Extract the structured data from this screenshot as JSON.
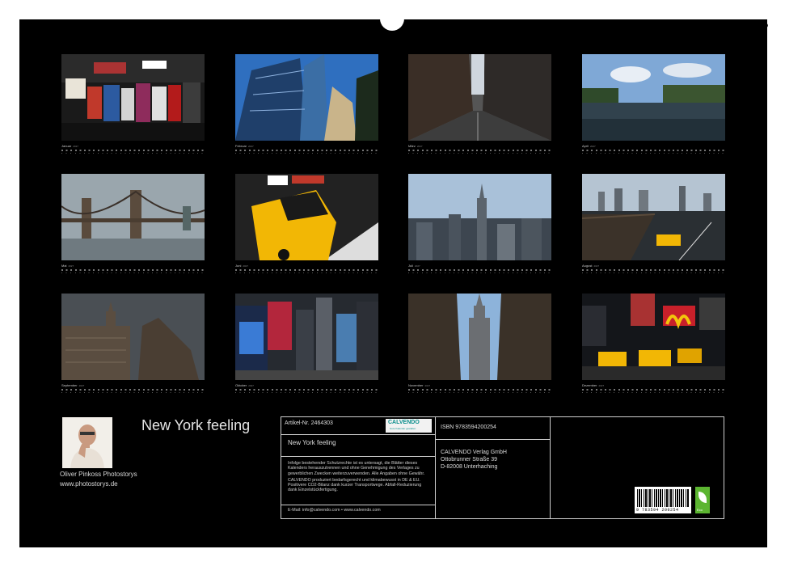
{
  "calendar": {
    "title": "New York feeling",
    "year": "2027",
    "months": [
      {
        "name": "Januar",
        "scene": "souvenir-stand"
      },
      {
        "name": "Februar",
        "scene": "glass-skyscrapers"
      },
      {
        "name": "März",
        "scene": "avenue-street"
      },
      {
        "name": "April",
        "scene": "harbor-water"
      },
      {
        "name": "Mai",
        "scene": "brooklyn-bridge"
      },
      {
        "name": "Juni",
        "scene": "yellow-taxi"
      },
      {
        "name": "Juli",
        "scene": "empire-state-skyline"
      },
      {
        "name": "August",
        "scene": "bridge-taxi-skyline"
      },
      {
        "name": "September",
        "scene": "classic-buildings"
      },
      {
        "name": "Oktober",
        "scene": "times-square"
      },
      {
        "name": "November",
        "scene": "empire-state-canyon"
      },
      {
        "name": "Dezember",
        "scene": "night-taxis"
      }
    ]
  },
  "author": {
    "name": "Oliver Pinkoss Photostorys",
    "url": "www.photostorys.de"
  },
  "info": {
    "artikel": "Artikel-Nr. 2464303",
    "logo_name": "CALVENDO",
    "logo_sub": "Gute Kalender gestalten",
    "title": "New York feeling",
    "legal_1": "Infolge bestehender Schutzrechte ist es untersagt, die Blätter dieses Kalenders herauszutrennen und ohne Genehmigung des Verlages zu gewerblichen Zwecken weiterzuverwenden. Alle Angaben ohne Gewähr.",
    "legal_2": "CALVENDO produziert bedarfsgerecht und klimabewusst in DE & EU. Positivere CO2-Bilanz dank kurzer Transportwege. Abfall-Reduzierung dank Einzelstückfertigung.",
    "email": "E-Mail: info@calvendo.com • www.calvendo.com",
    "isbn": "ISBN 9783594200254",
    "publisher": "CALVENDO Verlag GmbH",
    "street": "Ottobrunner Straße 39",
    "city": "D-82008 Unterhaching",
    "barcode_number": "9 783594 200254",
    "eco_label": "Eco"
  },
  "colors": {
    "background": "#000000",
    "text": "#dddddd",
    "taxi": "#f2b705",
    "sky": "#5b8fc9",
    "calvendo": "#0b8f8d",
    "eco": "#5cb531"
  }
}
